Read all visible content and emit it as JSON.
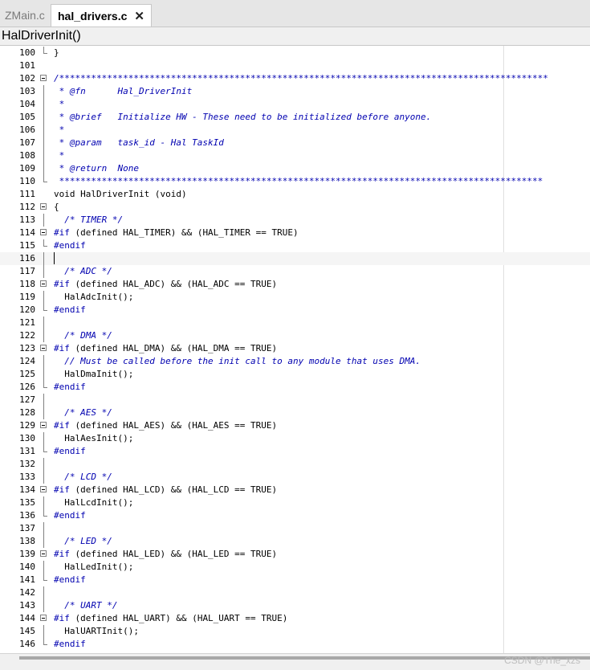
{
  "tabs": [
    {
      "label": "ZMain.c",
      "active": false
    },
    {
      "label": "hal_drivers.c",
      "active": true,
      "close_glyph": "✕"
    }
  ],
  "function_bar": {
    "label": "HalDriverInit()"
  },
  "lines": [
    {
      "n": "100",
      "fold": "end",
      "code": [
        {
          "t": "}",
          "c": "plain"
        }
      ]
    },
    {
      "n": "101",
      "fold": "",
      "code": []
    },
    {
      "n": "102",
      "fold": "box",
      "code": [
        {
          "t": "/********************************************************************************************",
          "c": "comment"
        }
      ]
    },
    {
      "n": "103",
      "fold": "line",
      "code": [
        {
          "t": " * @fn      Hal_DriverInit",
          "c": "comment"
        }
      ]
    },
    {
      "n": "104",
      "fold": "line",
      "code": [
        {
          "t": " *",
          "c": "comment"
        }
      ]
    },
    {
      "n": "105",
      "fold": "line",
      "code": [
        {
          "t": " * @brief   Initialize HW - These need to be initialized before anyone.",
          "c": "comment"
        }
      ]
    },
    {
      "n": "106",
      "fold": "line",
      "code": [
        {
          "t": " *",
          "c": "comment"
        }
      ]
    },
    {
      "n": "107",
      "fold": "line",
      "code": [
        {
          "t": " * @param   task_id - Hal TaskId",
          "c": "comment"
        }
      ]
    },
    {
      "n": "108",
      "fold": "line",
      "code": [
        {
          "t": " *",
          "c": "comment"
        }
      ]
    },
    {
      "n": "109",
      "fold": "line",
      "code": [
        {
          "t": " * @return  None",
          "c": "comment"
        }
      ]
    },
    {
      "n": "110",
      "fold": "end",
      "code": [
        {
          "t": " *******************************************************************************************",
          "c": "comment"
        }
      ]
    },
    {
      "n": "111",
      "fold": "",
      "code": [
        {
          "t": "void HalDriverInit (void)",
          "c": "plain"
        }
      ]
    },
    {
      "n": "112",
      "fold": "box",
      "code": [
        {
          "t": "{",
          "c": "plain"
        }
      ]
    },
    {
      "n": "113",
      "fold": "line",
      "code": [
        {
          "t": "  ",
          "c": "plain"
        },
        {
          "t": "/* TIMER */",
          "c": "comment"
        }
      ]
    },
    {
      "n": "114",
      "fold": "box",
      "code": [
        {
          "t": "#if",
          "c": "pre"
        },
        {
          "t": " (defined HAL_TIMER) && (HAL_TIMER == TRUE)",
          "c": "plain"
        }
      ]
    },
    {
      "n": "115",
      "fold": "end",
      "code": [
        {
          "t": "#endif",
          "c": "pre"
        }
      ]
    },
    {
      "n": "116",
      "fold": "line",
      "code": [],
      "current": true
    },
    {
      "n": "117",
      "fold": "line",
      "code": [
        {
          "t": "  ",
          "c": "plain"
        },
        {
          "t": "/* ADC */",
          "c": "comment"
        }
      ]
    },
    {
      "n": "118",
      "fold": "box",
      "code": [
        {
          "t": "#if",
          "c": "pre"
        },
        {
          "t": " (defined HAL_ADC) && (HAL_ADC == TRUE)",
          "c": "plain"
        }
      ]
    },
    {
      "n": "119",
      "fold": "line",
      "code": [
        {
          "t": "  HalAdcInit();",
          "c": "plain"
        }
      ]
    },
    {
      "n": "120",
      "fold": "end",
      "code": [
        {
          "t": "#endif",
          "c": "pre"
        }
      ]
    },
    {
      "n": "121",
      "fold": "line",
      "code": []
    },
    {
      "n": "122",
      "fold": "line",
      "code": [
        {
          "t": "  ",
          "c": "plain"
        },
        {
          "t": "/* DMA */",
          "c": "comment"
        }
      ]
    },
    {
      "n": "123",
      "fold": "box",
      "code": [
        {
          "t": "#if",
          "c": "pre"
        },
        {
          "t": " (defined HAL_DMA) && (HAL_DMA == TRUE)",
          "c": "plain"
        }
      ]
    },
    {
      "n": "124",
      "fold": "line",
      "code": [
        {
          "t": "  ",
          "c": "plain"
        },
        {
          "t": "// Must be called before the init call to any module that uses DMA.",
          "c": "comment"
        }
      ]
    },
    {
      "n": "125",
      "fold": "line",
      "code": [
        {
          "t": "  HalDmaInit();",
          "c": "plain"
        }
      ]
    },
    {
      "n": "126",
      "fold": "end",
      "code": [
        {
          "t": "#endif",
          "c": "pre"
        }
      ]
    },
    {
      "n": "127",
      "fold": "line",
      "code": []
    },
    {
      "n": "128",
      "fold": "line",
      "code": [
        {
          "t": "  ",
          "c": "plain"
        },
        {
          "t": "/* AES */",
          "c": "comment"
        }
      ]
    },
    {
      "n": "129",
      "fold": "box",
      "code": [
        {
          "t": "#if",
          "c": "pre"
        },
        {
          "t": " (defined HAL_AES) && (HAL_AES == TRUE)",
          "c": "plain"
        }
      ]
    },
    {
      "n": "130",
      "fold": "line",
      "code": [
        {
          "t": "  HalAesInit();",
          "c": "plain"
        }
      ]
    },
    {
      "n": "131",
      "fold": "end",
      "code": [
        {
          "t": "#endif",
          "c": "pre"
        }
      ]
    },
    {
      "n": "132",
      "fold": "line",
      "code": []
    },
    {
      "n": "133",
      "fold": "line",
      "code": [
        {
          "t": "  ",
          "c": "plain"
        },
        {
          "t": "/* LCD */",
          "c": "comment"
        }
      ]
    },
    {
      "n": "134",
      "fold": "box",
      "code": [
        {
          "t": "#if",
          "c": "pre"
        },
        {
          "t": " (defined HAL_LCD) && (HAL_LCD == TRUE)",
          "c": "plain"
        }
      ]
    },
    {
      "n": "135",
      "fold": "line",
      "code": [
        {
          "t": "  HalLcdInit();",
          "c": "plain"
        }
      ]
    },
    {
      "n": "136",
      "fold": "end",
      "code": [
        {
          "t": "#endif",
          "c": "pre"
        }
      ]
    },
    {
      "n": "137",
      "fold": "line",
      "code": []
    },
    {
      "n": "138",
      "fold": "line",
      "code": [
        {
          "t": "  ",
          "c": "plain"
        },
        {
          "t": "/* LED */",
          "c": "comment"
        }
      ]
    },
    {
      "n": "139",
      "fold": "box",
      "code": [
        {
          "t": "#if",
          "c": "pre"
        },
        {
          "t": " (defined HAL_LED) && (HAL_LED == TRUE)",
          "c": "plain"
        }
      ]
    },
    {
      "n": "140",
      "fold": "line",
      "code": [
        {
          "t": "  HalLedInit();",
          "c": "plain"
        }
      ]
    },
    {
      "n": "141",
      "fold": "end",
      "code": [
        {
          "t": "#endif",
          "c": "pre"
        }
      ]
    },
    {
      "n": "142",
      "fold": "line",
      "code": []
    },
    {
      "n": "143",
      "fold": "line",
      "code": [
        {
          "t": "  ",
          "c": "plain"
        },
        {
          "t": "/* UART */",
          "c": "comment"
        }
      ]
    },
    {
      "n": "144",
      "fold": "box",
      "code": [
        {
          "t": "#if",
          "c": "pre"
        },
        {
          "t": " (defined HAL_UART) && (HAL_UART == TRUE)",
          "c": "plain"
        }
      ]
    },
    {
      "n": "145",
      "fold": "line",
      "code": [
        {
          "t": "  HalUARTInit();",
          "c": "plain"
        }
      ]
    },
    {
      "n": "146",
      "fold": "end",
      "code": [
        {
          "t": "#endif",
          "c": "pre"
        }
      ]
    }
  ],
  "watermark": "CSDN @The_xzs",
  "colors": {
    "comment": "#0000b0",
    "preprocessor": "#0000b0",
    "text": "#000000"
  }
}
